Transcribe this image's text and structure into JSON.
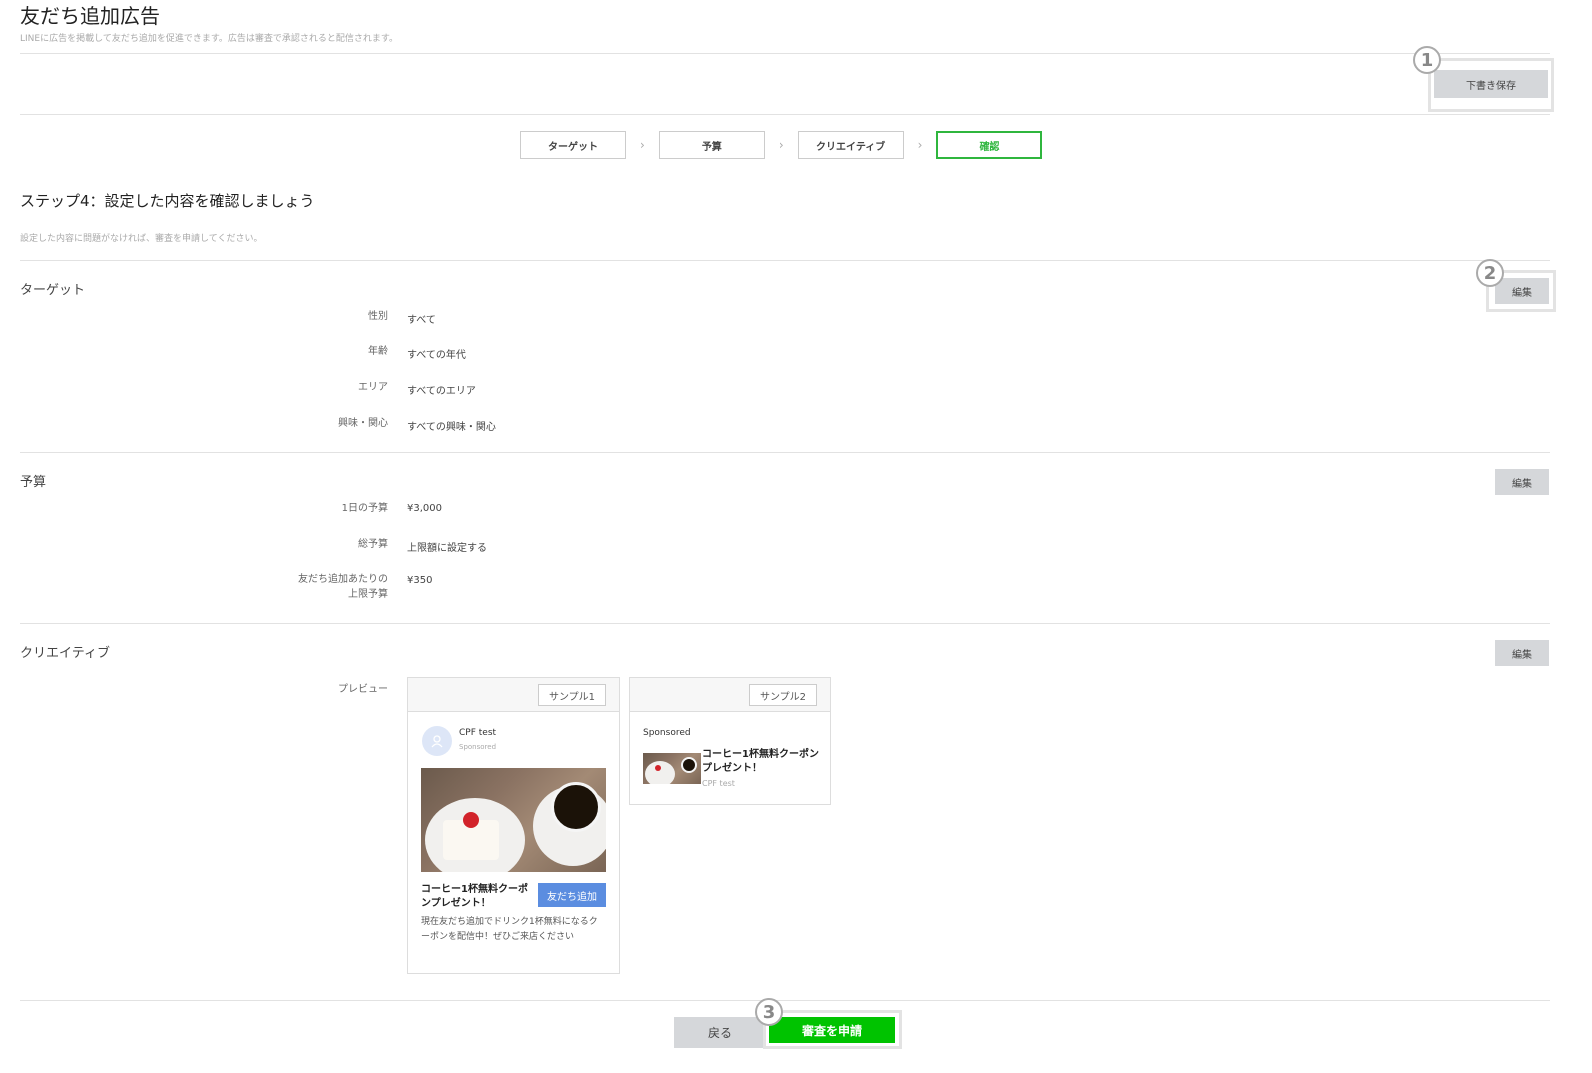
{
  "header": {
    "title": "友だち追加広告",
    "description": "LINEに広告を掲載して友だち追加を促進できます。広告は審査で承認されると配信されます。",
    "save_draft_label": "下書き保存"
  },
  "steps": [
    {
      "label": "ターゲット"
    },
    {
      "label": "予算"
    },
    {
      "label": "クリエイティブ"
    },
    {
      "label": "確認",
      "active": true
    }
  ],
  "step_heading": {
    "title": "ステップ4：設定した内容を確認しましょう",
    "description": "設定した内容に問題がなければ、審査を申請してください。"
  },
  "target_section": {
    "title": "ターゲット",
    "edit_label": "編集",
    "rows": [
      {
        "label": "性別",
        "value": "すべて"
      },
      {
        "label": "年齢",
        "value": "すべての年代"
      },
      {
        "label": "エリア",
        "value": "すべてのエリア"
      },
      {
        "label": "興味・関心",
        "value": "すべての興味・関心"
      }
    ]
  },
  "budget_section": {
    "title": "予算",
    "edit_label": "編集",
    "rows": [
      {
        "label": "1日の予算",
        "value": "¥3,000"
      },
      {
        "label": "総予算",
        "value": "上限額に設定する"
      },
      {
        "label": "友だち追加あたりの\n上限予算",
        "value": "¥350"
      }
    ]
  },
  "creative_section": {
    "title": "クリエイティブ",
    "edit_label": "編集",
    "preview_label": "プレビュー",
    "sample1": {
      "tag": "サンプル1",
      "account_name": "CPF test",
      "sponsored": "Sponsored",
      "headline": "コーヒー1杯無料クーポンプレゼント！",
      "button_label": "友だち追加",
      "body": "現在友だち追加でドリンク1杯無料になるクーポンを配信中！ぜひご来店ください"
    },
    "sample2": {
      "tag": "サンプル2",
      "sponsored": "Sponsored",
      "headline": "コーヒー1杯無料クーポンプレゼント！",
      "account_name": "CPF test"
    }
  },
  "footer": {
    "back_label": "戻る",
    "submit_label": "審査を申請"
  },
  "callouts": [
    "1",
    "2",
    "3"
  ],
  "colors": {
    "accent_green": "#00c300",
    "step_active": "#2fb63e",
    "add_friend_blue": "#5b8de0"
  },
  "icons": {
    "step_separator": "chevron-right-icon",
    "avatar": "user-icon"
  }
}
